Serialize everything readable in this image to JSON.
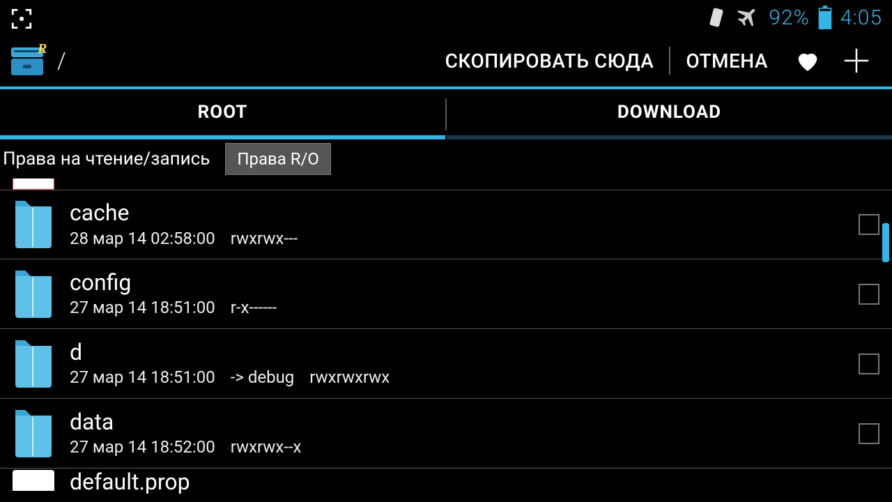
{
  "status_bar": {
    "battery_percent": "92%",
    "clock": "4:05"
  },
  "action_bar": {
    "path": "/",
    "copy_here": "СКОПИРОВАТЬ СЮДА",
    "cancel": "ОТМЕНА"
  },
  "tabs": {
    "root": "ROOT",
    "download": "DOWNLOAD",
    "active": 0
  },
  "mount_bar": {
    "label": "Права на чтение/запись",
    "button": "Права R/O"
  },
  "files": [
    {
      "name": "cache",
      "date": "28 мар 14 02:58:00",
      "perm": "rwxrwx---"
    },
    {
      "name": "config",
      "date": "27 мар 14 18:51:00",
      "perm": "r-x------"
    },
    {
      "name": "d",
      "date": "27 мар 14 18:51:00",
      "link": "-> debug",
      "perm": "rwxrwxrwx"
    },
    {
      "name": "data",
      "date": "27 мар 14 18:52:00",
      "perm": "rwxrwx--x"
    }
  ],
  "partial_next": {
    "name": "default.prop"
  },
  "colors": {
    "accent": "#33b5e5"
  }
}
